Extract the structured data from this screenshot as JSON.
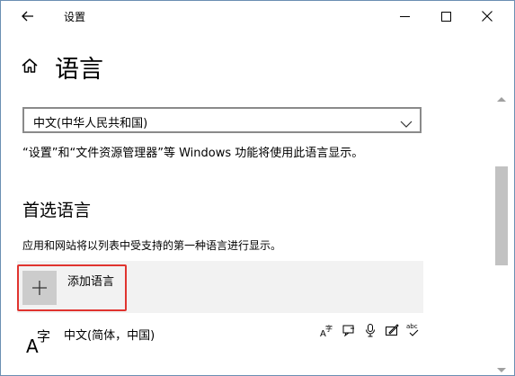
{
  "window": {
    "title": "设置",
    "controls": {
      "minimize_icon": "minimize-icon",
      "maximize_icon": "maximize-icon",
      "close_icon": "close-icon"
    }
  },
  "header": {
    "home_icon": "home-icon",
    "title": "语言"
  },
  "display_language": {
    "selected_value": "中文(中华人民共和国)",
    "description": "“设置”和“文件资源管理器”等 Windows 功能将使用此语言显示。"
  },
  "preferred_languages": {
    "title": "首选语言",
    "description": "应用和网站将以列表中受支持的第一种语言进行显示。",
    "add_button_label": "添加语言",
    "items": [
      {
        "name": "中文(简体，中国)",
        "features": [
          "display-language-icon",
          "speech-to-text-icon",
          "microphone-icon",
          "handwriting-icon",
          "spellcheck-icon"
        ]
      }
    ]
  },
  "colors": {
    "highlight_border": "#e0342f",
    "row_background": "#f2f2f2",
    "plus_box": "#cccccc",
    "scroll_thumb": "#c2c2c2"
  }
}
